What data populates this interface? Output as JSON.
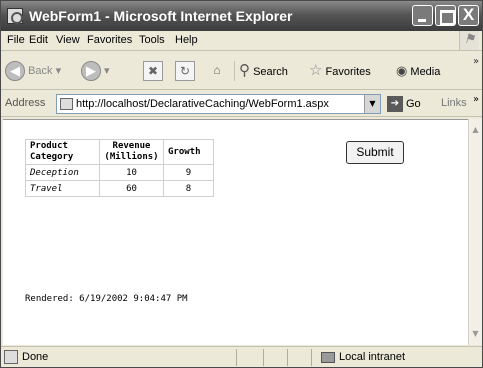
{
  "window": {
    "title": "WebForm1 - Microsoft Internet Explorer",
    "close_glyph": "X"
  },
  "menu": [
    "File",
    "Edit",
    "View",
    "Favorites",
    "Tools",
    "Help"
  ],
  "toolbar": {
    "back_label": "Back",
    "search_label": "Search",
    "favorites_label": "Favorites",
    "media_label": "Media"
  },
  "address": {
    "label": "Address",
    "url": "http://localhost/DeclarativeCaching/WebForm1.aspx",
    "go_label": "Go",
    "links_label": "Links"
  },
  "grid": {
    "headers": [
      "Product Category",
      "Revenue (Millions)",
      "Growth"
    ],
    "rows": [
      [
        "Deception",
        "10",
        "9"
      ],
      [
        "Travel",
        "60",
        "8"
      ]
    ]
  },
  "form": {
    "submit_label": "Submit",
    "rendered_text": "Rendered: 6/19/2002 9:04:47 PM"
  },
  "status": {
    "text": "Done",
    "zone": "Local intranet"
  }
}
